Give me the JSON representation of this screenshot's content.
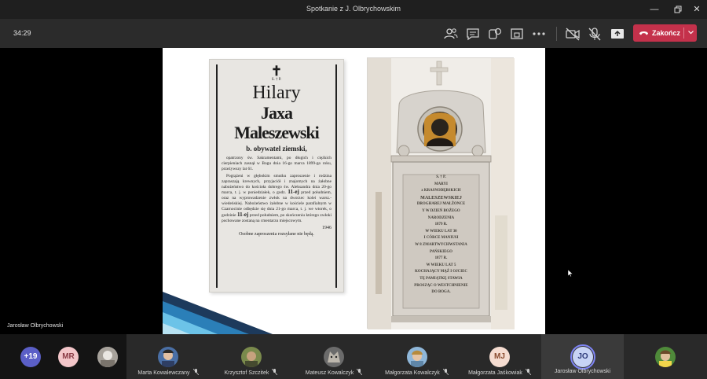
{
  "window": {
    "title": "Spotkanie z J. Olbrychowskim"
  },
  "toolbar": {
    "timer": "34:29",
    "end_call_label": "Zakończ",
    "icons": [
      "participants-icon",
      "chat-icon",
      "reactions-icon",
      "rooms-icon",
      "more-icon",
      "camera-off-icon",
      "mic-off-icon",
      "share-icon"
    ]
  },
  "slide": {
    "newspaper": {
      "sp": "S. † P.",
      "name_first": "Hilary",
      "name_last": "Jaxa Maleszewski",
      "title": "b. obywatel ziemski,",
      "para1": "opatrzony św. Sakramentami, po długich i ciężkich cierpieniach zasnął w Bogu dnia 16-go marca 1899-go roku, przeżywszy lat 61.",
      "para2": "Pogrążeni w głębokim smutku zaproszenie i rodzina zapraszają krewnych, przyjaciół i znajomych na żałobne nabożeństwo do kościoła dobrego św. Aleksandra dnia 20-go marca, t. j. w poniedziałek, o godz.",
      "time1": "11-ej",
      "para3": "przed południem, oraz na wyprowadzenie zwłok na dworzec kolei warsz.-wiedeńskiej. Nabożeństwo żałobne w kościele parafialnym w Czarnocinie odbędzie się dnia 21-go marca, t. j. we wtorek, o godzinie",
      "time2": "11-ej",
      "para4": "przed południem, po skończeniu którego zwłoki pochowane zostaną na cmentarzu miejscowym.",
      "number": "1946",
      "footer": "Osobne zaproszenia rozsyłane nie będą."
    },
    "plaque": {
      "sp": "S. † P.",
      "lines": [
        "S. † P.",
        "MARYI",
        "z KRASNODĘBSKICH",
        "MALESZEWSKIEJ",
        "DROGHAREJ MAŁŻONCE",
        "Y W DZIEŃ BOŻEGO",
        "NARODZENIA",
        "1879 R.",
        "W WIEKU LAT 30",
        "I CÓRCE MANIUSI",
        "W 8 ZMARTWYCHWSTANIA",
        "PAŃSKIEGO",
        "1877 R.",
        "W WIEKU LAT 5",
        "KOCHAJĄCY MĄŻ I OJCIEC",
        "TĘ PAMIĄTKĘ STAWIA",
        "PROSZĄC O WESTCHNIENIE",
        "DO BOGA."
      ]
    }
  },
  "presenter_label": "Jarosław Olbrychowski",
  "participants": {
    "overflow": "+19",
    "tiles": [
      {
        "initials": "MR",
        "name": ""
      },
      {
        "initials": "",
        "name": ""
      },
      {
        "initials": "",
        "name": "Marta Kowalewczany"
      },
      {
        "initials": "",
        "name": "Krzysztof Szczitek"
      },
      {
        "initials": "",
        "name": "Mateusz Kowalczyk"
      },
      {
        "initials": "",
        "name": "Małgorzata Kowalczyk"
      },
      {
        "initials": "MJ",
        "name": "Małgorzata Jaśkowiak"
      },
      {
        "initials": "JO",
        "name": "Jarosław Olbrychowski"
      },
      {
        "initials": "",
        "name": ""
      }
    ]
  },
  "colors": {
    "accent_end_call": "#c4314b",
    "overflow_avatar": "#5b5fc7",
    "mr_avatar": "#f3c6c9",
    "mj_avatar": "#f5dcd0",
    "jo_avatar": "#c8d3f5"
  }
}
